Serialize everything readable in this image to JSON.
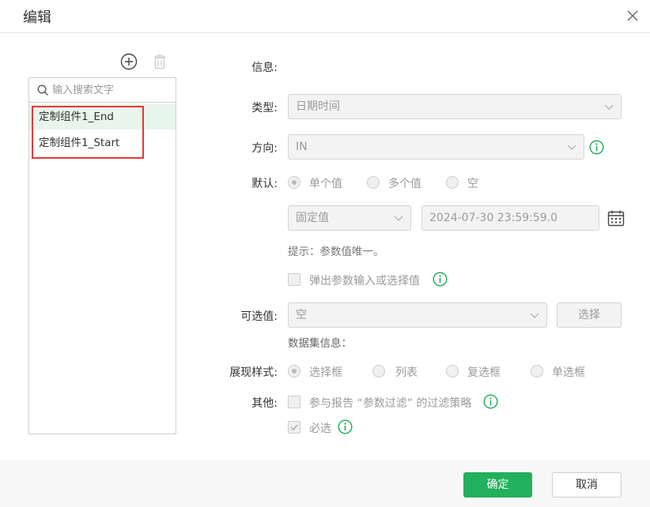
{
  "dialog": {
    "title": "编辑",
    "ok_label": "确定",
    "cancel_label": "取消"
  },
  "left_panel": {
    "search_placeholder": "输入搜索文字",
    "items": [
      {
        "label": "定制组件1_End",
        "selected": true
      },
      {
        "label": "定制组件1_Start",
        "selected": false
      }
    ]
  },
  "form": {
    "info_label": "信息:",
    "type_label": "类型:",
    "type_value": "日期时间",
    "direction_label": "方向:",
    "direction_value": "IN",
    "default_label": "默认:",
    "default_options": [
      "单个值",
      "多个值",
      "空"
    ],
    "default_selected": "单个值",
    "fixed_value": "固定值",
    "datetime_value": "2024-07-30 23:59:59.0",
    "hint": "提示：参数值唯一。",
    "popup_checkbox_label": "弹出参数输入或选择值",
    "optional_label": "可选值:",
    "optional_value": "空",
    "choose_button": "选择",
    "dataset_info": "数据集信息：",
    "display_style_label": "展现样式:",
    "display_options": [
      "选择框",
      "列表",
      "复选框",
      "单选框"
    ],
    "display_selected": "选择框",
    "other_label": "其他:",
    "participate_label": "参与报告 “参数过滤” 的过滤策略",
    "required_label": "必选",
    "required_checked": true
  },
  "colors": {
    "primary": "#22b05c",
    "info_icon": "#22b05c",
    "highlight": "#e53935"
  }
}
